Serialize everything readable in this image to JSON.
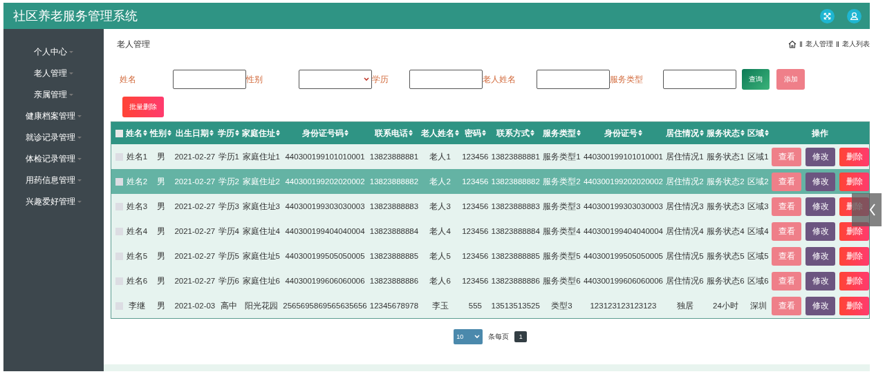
{
  "header": {
    "title": "社区养老服务管理系统"
  },
  "sidebar": {
    "items": [
      {
        "label": "个人中心"
      },
      {
        "label": "老人管理"
      },
      {
        "label": "亲属管理"
      },
      {
        "label": "健康档案管理"
      },
      {
        "label": "就诊记录管理"
      },
      {
        "label": "体检记录管理"
      },
      {
        "label": "用药信息管理"
      },
      {
        "label": "兴趣爱好管理"
      }
    ]
  },
  "page_title": "老人管理",
  "breadcrumb": [
    "老人管理",
    "老人列表"
  ],
  "filters": [
    {
      "label": "姓名",
      "kind": "text"
    },
    {
      "label": "性别",
      "kind": "select"
    },
    {
      "label": "学历",
      "kind": "text"
    },
    {
      "label": "老人姓名",
      "kind": "text"
    },
    {
      "label": "服务类型",
      "kind": "text"
    }
  ],
  "search_button": "查询",
  "add_button": "添加",
  "batch_delete_button": "批量删除",
  "table": {
    "select_all_checked": false,
    "columns": [
      {
        "label": "姓名",
        "sortable": true
      },
      {
        "label": "性别",
        "sortable": true
      },
      {
        "label": "出生日期",
        "sortable": true
      },
      {
        "label": "学历",
        "sortable": true
      },
      {
        "label": "家庭住址",
        "sortable": true
      },
      {
        "label": "身份证号码",
        "sortable": true
      },
      {
        "label": "联系电话",
        "sortable": true
      },
      {
        "label": "老人姓名",
        "sortable": true
      },
      {
        "label": "密码",
        "sortable": true
      },
      {
        "label": "联系方式",
        "sortable": true
      },
      {
        "label": "服务类型",
        "sortable": true
      },
      {
        "label": "身份证号",
        "sortable": true
      },
      {
        "label": "居住情况",
        "sortable": true
      },
      {
        "label": "服务状态",
        "sortable": true
      },
      {
        "label": "区域",
        "sortable": true
      },
      {
        "label": "操作",
        "sortable": false
      }
    ],
    "rows": [
      {
        "selected": false,
        "checked": false,
        "cells": [
          "姓名1",
          "男",
          "2021-02-27",
          "学历1",
          "家庭住址1",
          "440300199101010001",
          "13823888881",
          "老人1",
          "123456",
          "13823888881",
          "服务类型1",
          "440300199101010001",
          "居住情况1",
          "服务状态1",
          "区域1"
        ],
        "actions": [
          "查看",
          "修改",
          "删除"
        ]
      },
      {
        "selected": true,
        "checked": false,
        "cells": [
          "姓名2",
          "男",
          "2021-02-27",
          "学历2",
          "家庭住址2",
          "440300199202020002",
          "13823888882",
          "老人2",
          "123456",
          "13823888882",
          "服务类型2",
          "440300199202020002",
          "居住情况2",
          "服务状态2",
          "区域2"
        ],
        "actions": [
          "查看",
          "修改",
          "删除"
        ]
      },
      {
        "selected": false,
        "checked": false,
        "cells": [
          "姓名3",
          "男",
          "2021-02-27",
          "学历3",
          "家庭住址3",
          "440300199303030003",
          "13823888883",
          "老人3",
          "123456",
          "13823888883",
          "服务类型3",
          "440300199303030003",
          "居住情况3",
          "服务状态3",
          "区域3"
        ],
        "actions": [
          "查看",
          "修改",
          "删除"
        ]
      },
      {
        "selected": false,
        "checked": false,
        "cells": [
          "姓名4",
          "男",
          "2021-02-27",
          "学历4",
          "家庭住址4",
          "440300199404040004",
          "13823888884",
          "老人4",
          "123456",
          "13823888884",
          "服务类型4",
          "440300199404040004",
          "居住情况4",
          "服务状态4",
          "区域4"
        ],
        "actions": [
          "查看",
          "修改",
          "删除"
        ]
      },
      {
        "selected": false,
        "checked": false,
        "cells": [
          "姓名5",
          "男",
          "2021-02-27",
          "学历5",
          "家庭住址5",
          "440300199505050005",
          "13823888885",
          "老人5",
          "123456",
          "13823888885",
          "服务类型5",
          "440300199505050005",
          "居住情况5",
          "服务状态5",
          "区域5"
        ],
        "actions": [
          "查看",
          "修改",
          "删除"
        ]
      },
      {
        "selected": false,
        "checked": false,
        "cells": [
          "姓名6",
          "男",
          "2021-02-27",
          "学历6",
          "家庭住址6",
          "440300199606060006",
          "13823888886",
          "老人6",
          "123456",
          "13823888886",
          "服务类型6",
          "440300199606060006",
          "居住情况6",
          "服务状态6",
          "区域6"
        ],
        "actions": [
          "查看",
          "修改",
          "删除"
        ]
      },
      {
        "selected": false,
        "checked": false,
        "cells": [
          "李继",
          "男",
          "2021-02-03",
          "高中",
          "阳光花园",
          "2565695869565635656",
          "12345678978",
          "李玉",
          "555",
          "13513513525",
          "类型3",
          "123123123123123",
          "独居",
          "24小时",
          "深圳"
        ],
        "actions": [
          "查看",
          "修改",
          "删除"
        ]
      }
    ]
  },
  "pagination": {
    "page_size": "10",
    "page_size_label": "条每页",
    "pages": [
      {
        "label": "1",
        "selected": true
      }
    ]
  }
}
